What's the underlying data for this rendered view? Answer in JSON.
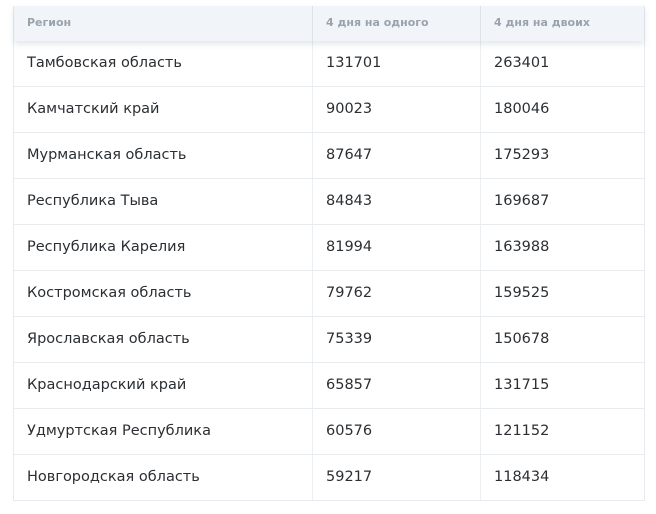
{
  "table": {
    "columns": [
      "Регион",
      "4 дня на одного",
      "4 дня на двоих"
    ],
    "rows": [
      [
        "Тамбовская область",
        "131701",
        "263401"
      ],
      [
        "Камчатский край",
        "90023",
        "180046"
      ],
      [
        "Мурманская область",
        "87647",
        "175293"
      ],
      [
        "Республика Тыва",
        "84843",
        "169687"
      ],
      [
        "Республика Карелия",
        "81994",
        "163988"
      ],
      [
        "Костромская область",
        "79762",
        "159525"
      ],
      [
        "Ярославская область",
        "75339",
        "150678"
      ],
      [
        "Краснодарский край",
        "65857",
        "131715"
      ],
      [
        "Удмуртская Республика",
        "60576",
        "121152"
      ],
      [
        "Новгородская область",
        "59217",
        "118434"
      ]
    ]
  }
}
